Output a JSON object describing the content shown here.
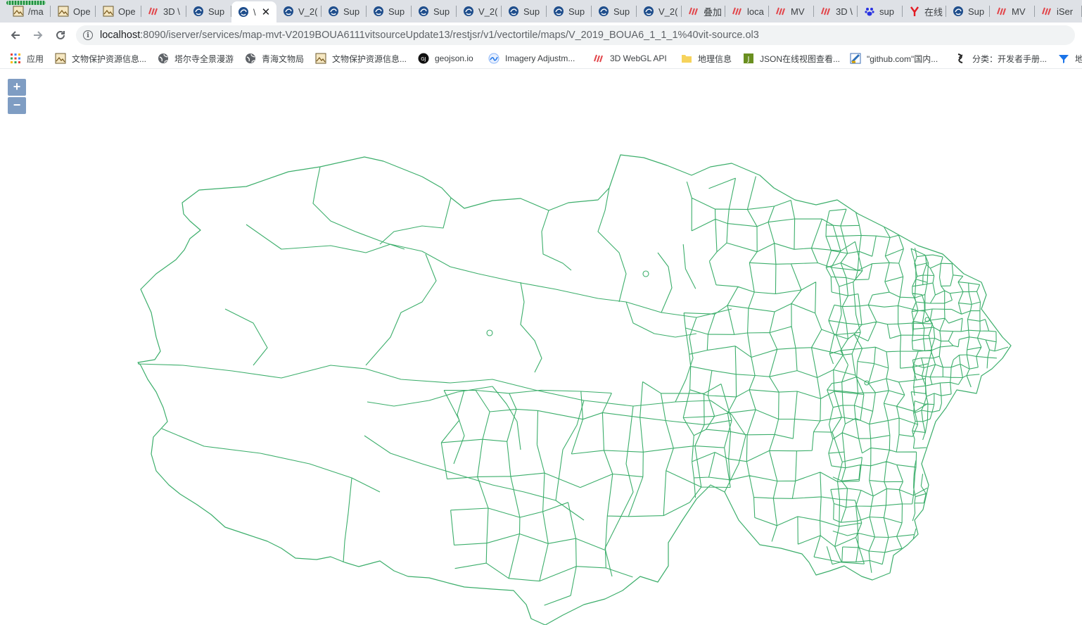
{
  "tabs": [
    {
      "title": "/ma",
      "icon": "map-page-icon",
      "active": false
    },
    {
      "title": "Ope",
      "icon": "map-page-icon",
      "active": false
    },
    {
      "title": "Ope",
      "icon": "map-page-icon",
      "active": false
    },
    {
      "title": "3D \\",
      "icon": "supermap-red-icon",
      "active": false
    },
    {
      "title": "Sup",
      "icon": "iserver-icon",
      "active": false
    },
    {
      "title": "\\",
      "icon": "iserver-icon",
      "active": true
    },
    {
      "title": "V_2(",
      "icon": "iserver-icon",
      "active": false
    },
    {
      "title": "Sup",
      "icon": "iserver-icon",
      "active": false
    },
    {
      "title": "Sup",
      "icon": "iserver-icon",
      "active": false
    },
    {
      "title": "Sup",
      "icon": "iserver-icon",
      "active": false
    },
    {
      "title": "V_2(",
      "icon": "iserver-icon",
      "active": false
    },
    {
      "title": "Sup",
      "icon": "iserver-icon",
      "active": false
    },
    {
      "title": "Sup",
      "icon": "iserver-icon",
      "active": false
    },
    {
      "title": "Sup",
      "icon": "iserver-icon",
      "active": false
    },
    {
      "title": "V_2(",
      "icon": "iserver-icon",
      "active": false
    },
    {
      "title": "叠加",
      "icon": "supermap-red-icon",
      "active": false
    },
    {
      "title": "loca",
      "icon": "supermap-red-icon",
      "active": false
    },
    {
      "title": "MV",
      "icon": "supermap-red-icon",
      "active": false
    },
    {
      "title": "3D \\",
      "icon": "supermap-red-icon",
      "active": false
    },
    {
      "title": "sup",
      "icon": "baidu-paw-icon",
      "active": false
    },
    {
      "title": "在线",
      "icon": "youdao-y-icon",
      "active": false
    },
    {
      "title": "Sup",
      "icon": "iserver-icon",
      "active": false
    },
    {
      "title": "MV",
      "icon": "supermap-red-icon",
      "active": false
    },
    {
      "title": "iSer",
      "icon": "supermap-red-icon",
      "active": false
    }
  ],
  "toolbar": {
    "url_host": "localhost",
    "url_rest": ":8090/iserver/services/map-mvt-V2019BOUA6111vitsourceUpdate13/restjsr/v1/vectortile/maps/V_2019_BOUA6_1_1_1%40vit-source.ol3"
  },
  "bookmarks": [
    {
      "label": "应用",
      "icon": "apps-grid-icon"
    },
    {
      "label": "文物保护资源信息...",
      "icon": "map-page-icon"
    },
    {
      "label": "塔尔寺全景漫游",
      "icon": "globe-icon"
    },
    {
      "label": "青海文物局",
      "icon": "globe-icon"
    },
    {
      "label": "文物保护资源信息...",
      "icon": "map-page-icon"
    },
    {
      "label": "geojson.io",
      "icon": "geojson-icon"
    },
    {
      "label": "Imagery Adjustm...",
      "icon": "imagery-icon"
    },
    {
      "label": "3D WebGL API",
      "icon": "supermap-red-icon"
    },
    {
      "label": "地理信息",
      "icon": "folder-icon"
    },
    {
      "label": "JSON在线视图查看...",
      "icon": "json-viewer-icon"
    },
    {
      "label": "\"github.com\"国内...",
      "icon": "github-proxy-icon"
    },
    {
      "label": "分类：开发者手册...",
      "icon": "devmanual-icon"
    },
    {
      "label": "地",
      "icon": "funnel-icon"
    }
  ],
  "map": {
    "zoom_in_label": "+",
    "zoom_out_label": "−",
    "boundary_color": "#3cae6b"
  }
}
